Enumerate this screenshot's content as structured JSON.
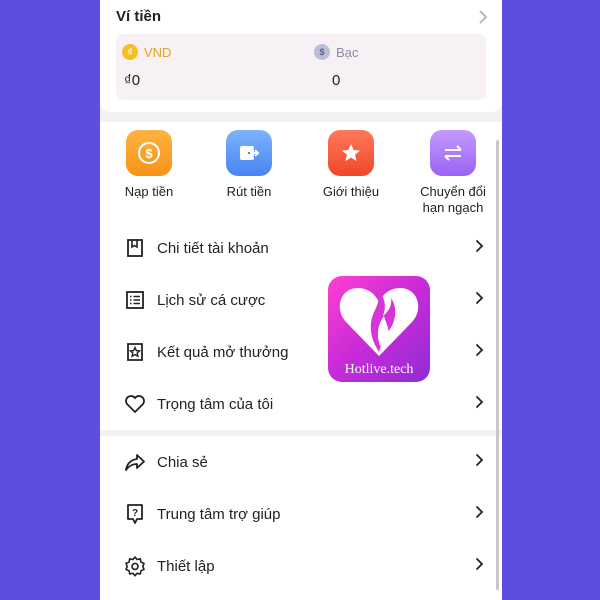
{
  "wallet": {
    "title": "Ví tiền",
    "vnd": {
      "label": "VND",
      "amount": "₫0"
    },
    "bac": {
      "label": "Bạc",
      "amount": "0"
    }
  },
  "actions": [
    {
      "label": "Nạp tiền",
      "icon": "dollar-coin-icon"
    },
    {
      "label": "Rút tiền",
      "icon": "wallet-withdraw-icon"
    },
    {
      "label": "Giới thiệu",
      "icon": "star-icon"
    },
    {
      "label_line1": "Chuyển đổi",
      "label_line2": "hạn ngạch",
      "icon": "exchange-arrows-icon"
    }
  ],
  "menu": [
    {
      "label": "Chi tiết tài khoản",
      "icon": "bookmark-icon"
    },
    {
      "label": "Lịch sử cá cược",
      "icon": "list-icon"
    },
    {
      "label": "Kết quả mở thưởng",
      "icon": "star-badge-icon"
    },
    {
      "label": "Trọng tâm của tôi",
      "icon": "heart-icon"
    },
    {
      "label": "Chia sẻ",
      "icon": "share-icon"
    },
    {
      "label": "Trung tâm trợ giúp",
      "icon": "help-icon"
    },
    {
      "label": "Thiết lập",
      "icon": "settings-icon"
    }
  ],
  "watermark": {
    "text": "Hotlive.tech"
  },
  "colors": {
    "background": "#5d4ee0",
    "vnd_accent": "#e8a21c",
    "nap": "#f59316",
    "rut": "#4785f0",
    "gioi": "#f04628",
    "chuyen": "#9a63f3"
  }
}
